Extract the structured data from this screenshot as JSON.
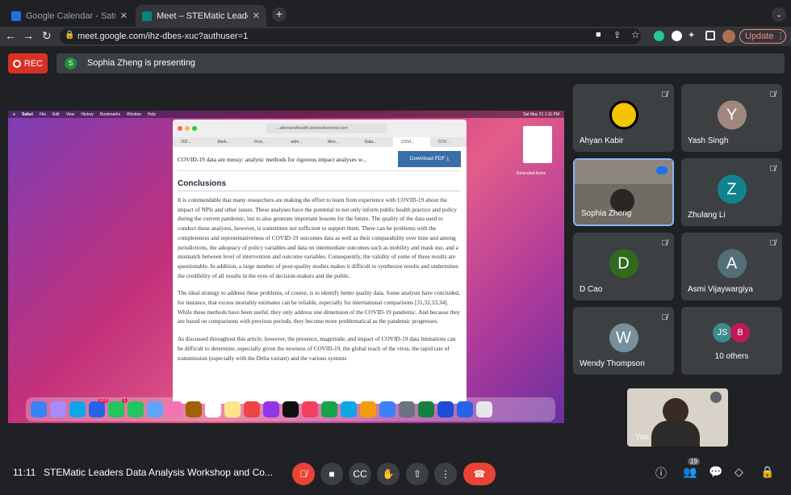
{
  "browser": {
    "tabs": [
      {
        "title": "Google Calendar - Saturday,",
        "active": false
      },
      {
        "title": "Meet – STEMatic Leaders D",
        "active": true
      }
    ],
    "url": "meet.google.com/ihz-dbes-xuc?authuser=1",
    "update_label": "Update"
  },
  "meet": {
    "rec_label": "REC",
    "presenter_initial": "S",
    "presenting_text": "Sophia Zheng is presenting",
    "time": "11:11",
    "meeting_title": "STEMatic Leaders Data Analysis Workshop and Co...",
    "people_count": "19",
    "participants": [
      {
        "name": "Ahyan Kabir",
        "initial": "",
        "color": "#000000"
      },
      {
        "name": "Yash Singh",
        "initial": "Y",
        "color": "#a1887f"
      },
      {
        "name": "Sophia Zheng",
        "initial": "",
        "color": "#5f6368"
      },
      {
        "name": "Zhulang Li",
        "initial": "Z",
        "color": "#12838e"
      },
      {
        "name": "D Cao",
        "initial": "D",
        "color": "#33691e"
      },
      {
        "name": "Asmi Vijaywargiya",
        "initial": "A",
        "color": "#546e7a"
      },
      {
        "name": "Wendy Thompson",
        "initial": "W",
        "color": "#78909c"
      },
      {
        "name": "10 others",
        "initial": "JS",
        "initial2": "B",
        "color": "#3f8a8a",
        "color2": "#c2185b"
      }
    ],
    "self_label": "You"
  },
  "shared_screen": {
    "menu": [
      "Safari",
      "File",
      "Edit",
      "View",
      "History",
      "Bookmarks",
      "Window",
      "Help"
    ],
    "clock": "Sat May 21  1:11 PM",
    "address": "...ationandhealth.biomedcentral.com",
    "bookmark_tabs": [
      "202...",
      "Mark...",
      "First...",
      "adm...",
      "Mee...",
      "Data...",
      "COVI...",
      "COV..."
    ],
    "article_heading_short": "COVID-19 data are messy: analytic methods for rigorous impact analyses w...",
    "download_label": "Download PDF",
    "section_title": "Conclusions",
    "paragraphs": [
      "It is commendable that many researchers are making the effort to learn from experience with COVID-19 about the impact of NPIs and other issues. These analyses have the potential to not only inform public health practice and policy during the current pandemic, but to also generate important lessons for the future. The quality of the data used to conduct these analyses, however, is sometimes not sufficient to support them. There can be problems with the completeness and representativeness of COVID-19 outcomes data as well as their comparability over time and among jurisdictions, the adequacy of policy variables and data on intermediate outcomes such as mobility and mask use, and a mismatch between level of intervention and outcome variables. Consequently, the validity of some of these results are questionable. In addition, a large number of poor-quality studies makes it difficult to synthesize results and undermines the credibility of all results in the eyes of decision-makers and the public.",
      "The ideal strategy to address these problems, of course, is to identify better quality data. Some analysts have concluded, for instance, that excess mortality estimates can be reliable, especially for international comparisons [31,32,33,34]. While these methods have been useful, they only address one dimension of the COVID-19 pandemic. And because they are based on comparisons with previous periods, they become more problematical as the pandemic progresses.",
      "As discussed throughout this article, however, the presence, magnitude, and impact of COVID-19 data limitations can be difficult to determine, especially given the newness of COVID-19, the global reach of the virus, the rapid rate of transmission (especially with the Delta variant) and the various systems"
    ],
    "desktop_file": "Relocated Items",
    "dock_badge_mail": "173",
    "dock_badge_cal": "1"
  }
}
